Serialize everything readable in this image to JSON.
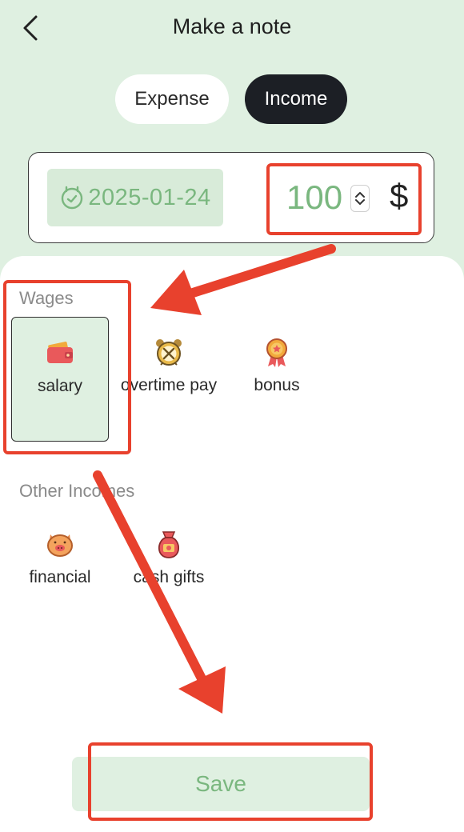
{
  "header": {
    "title": "Make a note",
    "back_icon": "chevron-left-icon"
  },
  "type_toggle": {
    "options": [
      "Expense",
      "Income"
    ],
    "selected": "Income"
  },
  "entry": {
    "date": "2025-01-24",
    "date_icon": "calendar-icon",
    "amount": "100",
    "currency": "$"
  },
  "sections": [
    {
      "title": "Wages",
      "items": [
        {
          "label": "salary",
          "icon": "wallet-icon",
          "selected": true
        },
        {
          "label": "overtime pay",
          "icon": "alarm-clock-icon",
          "selected": false
        },
        {
          "label": "bonus",
          "icon": "medal-icon",
          "selected": false
        }
      ]
    },
    {
      "title": "Other Incomes",
      "items": [
        {
          "label": "financial",
          "icon": "piggy-bank-icon",
          "selected": false
        },
        {
          "label": "cash gifts",
          "icon": "money-bag-icon",
          "selected": false
        }
      ]
    }
  ],
  "save_label": "Save",
  "colors": {
    "background_top": "#dff0e1",
    "accent_green": "#7ab77f",
    "toggle_dark": "#1c1f25",
    "annotation_red": "#e8412d"
  }
}
